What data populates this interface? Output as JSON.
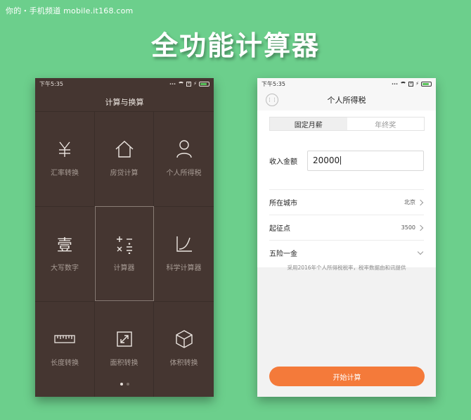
{
  "watermark": "你的・手机频道 mobile.it168.com",
  "headline": "全功能计算器",
  "left_phone": {
    "status_time": "下午5:35",
    "title": "计算与换算",
    "tiles": [
      {
        "label": "汇率转换",
        "icon": "yen-icon"
      },
      {
        "label": "房贷计算",
        "icon": "house-icon"
      },
      {
        "label": "个人所得税",
        "icon": "person-icon"
      },
      {
        "label": "大写数字",
        "icon": "chinese-numeral-icon",
        "glyph": "壹"
      },
      {
        "label": "计算器",
        "icon": "calculator-icon"
      },
      {
        "label": "科学计算器",
        "icon": "curve-graph-icon"
      },
      {
        "label": "长度转换",
        "icon": "ruler-icon"
      },
      {
        "label": "面积转换",
        "icon": "expand-arrows-icon"
      },
      {
        "label": "体积转换",
        "icon": "cube-icon"
      }
    ],
    "selected_tile": "计算器",
    "page_indicator": {
      "pages": 2,
      "current": 1
    }
  },
  "right_phone": {
    "status_time": "下午5:35",
    "title": "个人所得税",
    "tabs": [
      {
        "label": "固定月薪",
        "active": true
      },
      {
        "label": "年终奖",
        "active": false
      }
    ],
    "income": {
      "label": "收入金额",
      "value": "20000"
    },
    "rows": [
      {
        "label": "所在城市",
        "value": "北京"
      },
      {
        "label": "起征点",
        "value": "3500"
      },
      {
        "label": "五险一金",
        "value": ""
      }
    ],
    "note": "采用2016年个人所得税税率，税率数据由和讯提供",
    "start_button": "开始计算"
  },
  "colors": {
    "background": "#6ccf8c",
    "dark_panel": "#453631",
    "accent_button": "#f47a3a",
    "battery": "#58c159"
  }
}
